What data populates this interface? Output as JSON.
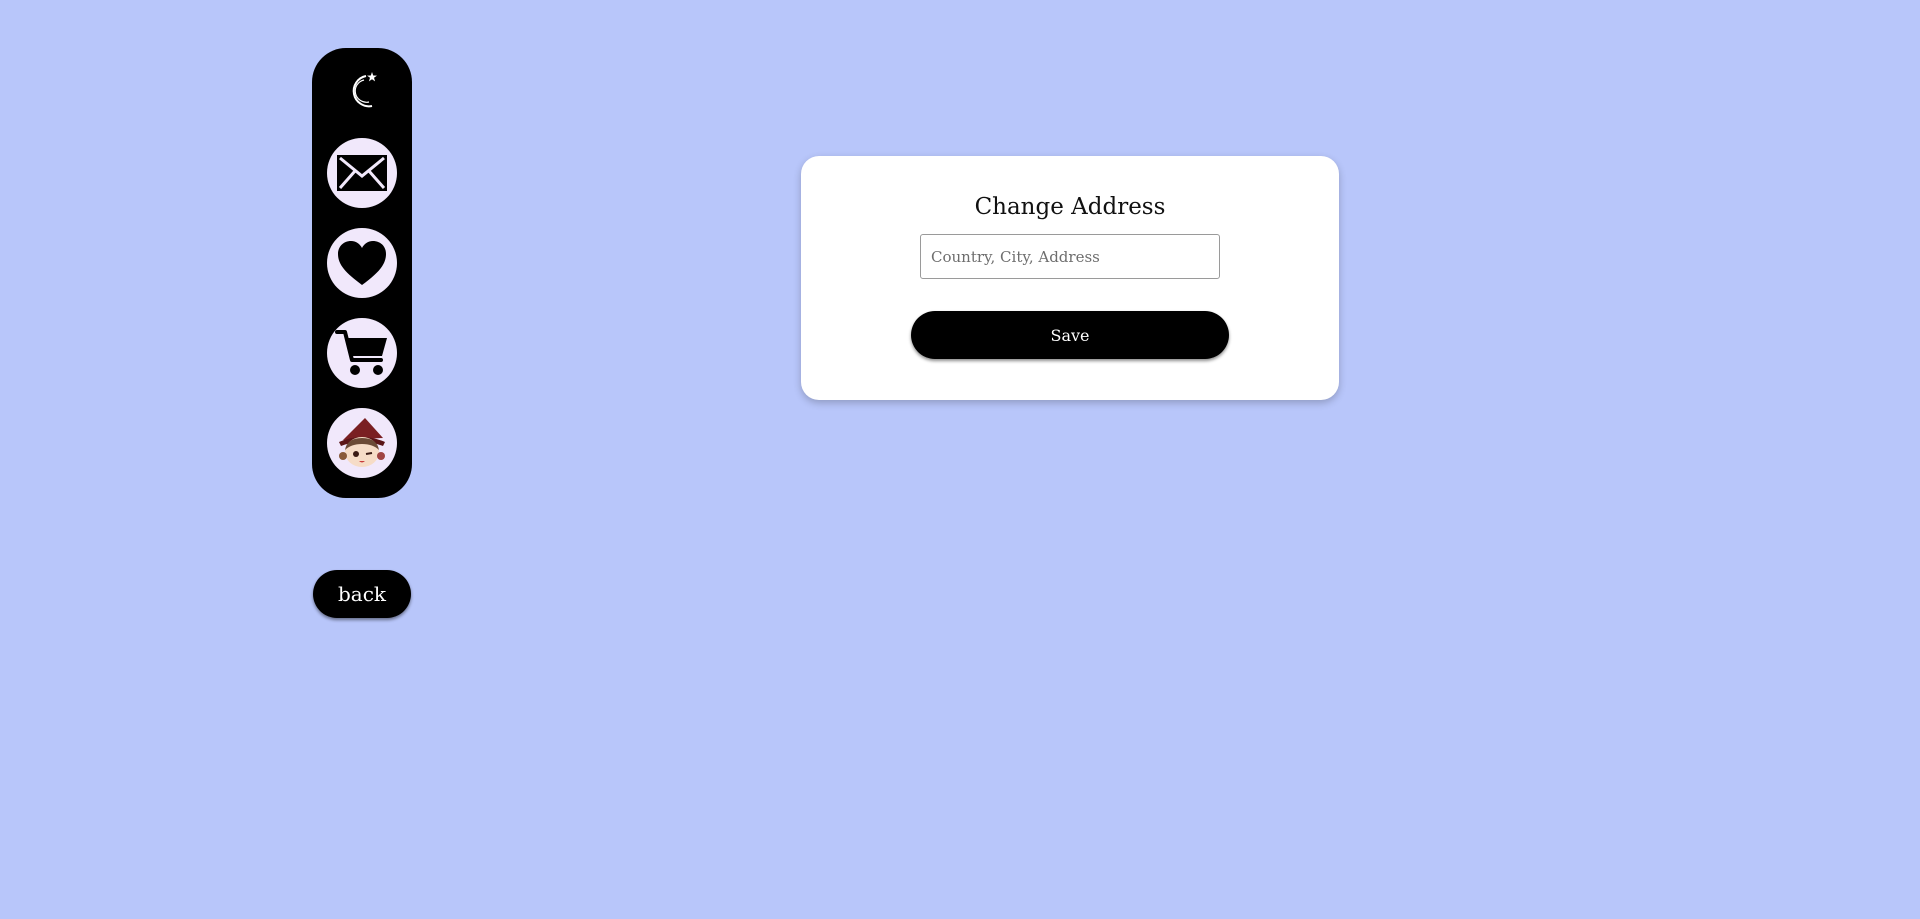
{
  "colors": {
    "background": "#b8c6fa",
    "sidebar": "#000000",
    "nav_button_bg": "#f1e8fb",
    "card": "#ffffff",
    "button": "#000000",
    "button_text": "#ffffff"
  },
  "sidebar": {
    "logo_icon": "crescent-moon-star-icon",
    "items": [
      {
        "icon": "mail-icon"
      },
      {
        "icon": "heart-icon"
      },
      {
        "icon": "cart-icon"
      },
      {
        "icon": "avatar"
      }
    ]
  },
  "back_label": "back",
  "card": {
    "title": "Change Address",
    "input_placeholder": "Country, City, Address",
    "input_value": "",
    "save_label": "Save"
  }
}
